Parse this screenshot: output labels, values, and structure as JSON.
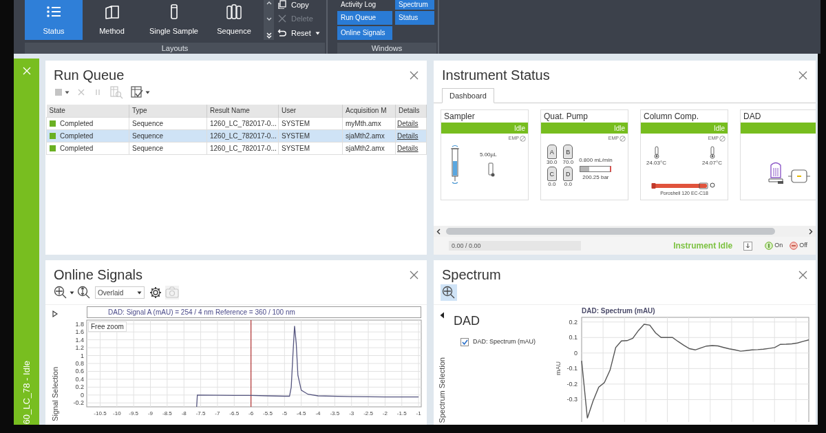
{
  "ribbon": {
    "layout_buttons": [
      {
        "label": "Status",
        "selected": true
      },
      {
        "label": "Method",
        "selected": false
      },
      {
        "label": "Single Sample",
        "selected": false
      },
      {
        "label": "Sequence",
        "selected": false
      }
    ],
    "layout_actions": [
      {
        "label": "Copy",
        "disabled": false,
        "dropdown": false
      },
      {
        "label": "Delete",
        "disabled": true,
        "dropdown": false
      },
      {
        "label": "Reset",
        "disabled": false,
        "dropdown": true
      }
    ],
    "layouts_label": "Layouts",
    "window_buttons": [
      {
        "label": "Activity Log",
        "active": false
      },
      {
        "label": "Spectrum",
        "active": true
      },
      {
        "label": "Run Queue",
        "active": true
      },
      {
        "label": "Status",
        "active": true
      },
      {
        "label": "Online Signals",
        "active": true
      }
    ],
    "windows_label": "Windows"
  },
  "instrument_tab": {
    "label": "60_LC_78 - Idle"
  },
  "run_queue": {
    "title": "Run Queue",
    "toolbar": [
      {
        "disabled": true,
        "dropdown": true
      },
      {
        "disabled": true,
        "dropdown": false
      },
      {
        "disabled": true,
        "dropdown": false
      },
      {
        "disabled": true,
        "dropdown": false
      },
      {
        "disabled": false,
        "dropdown": true
      }
    ],
    "columns": [
      "State",
      "Type",
      "Result Name",
      "User",
      "Acquisition M",
      "Details"
    ],
    "rows": [
      {
        "state": "Completed",
        "color": "#6ab023",
        "type": "Sequence",
        "result_name": "1260_LC_782017-0...",
        "user": "SYSTEM",
        "method": "myMth.amx",
        "details": "Details",
        "selected": false
      },
      {
        "state": "Completed",
        "color": "#6ab023",
        "type": "Sequence",
        "result_name": "1260_LC_782017-0...",
        "user": "SYSTEM",
        "method": "sjaMth2.amx",
        "details": "Details",
        "selected": true
      },
      {
        "state": "Completed",
        "color": "#6ab023",
        "type": "Sequence",
        "result_name": "1260_LC_782017-0...",
        "user": "SYSTEM",
        "method": "sjaMth2.amx",
        "details": "Details",
        "selected": false
      }
    ]
  },
  "instrument_status": {
    "title": "Instrument Status",
    "tabs": [
      {
        "label": "Dashboard",
        "selected": true
      }
    ],
    "modules": [
      {
        "kind": "sampler",
        "name": "Sampler",
        "status": "Idle",
        "color": "#77bd1f",
        "badge": "EMP",
        "volume": "5.00µL"
      },
      {
        "kind": "pump",
        "name": "Quat. Pump",
        "status": "Idle",
        "color": "#77bd1f",
        "badge": "EMP",
        "solvents": [
          {
            "letter": "A",
            "percent": "30.0"
          },
          {
            "letter": "B",
            "percent": "70.0"
          },
          {
            "letter": "C",
            "percent": "0.0"
          },
          {
            "letter": "D",
            "percent": "0.0"
          }
        ],
        "flow": "0.800 mL/min",
        "pressure": "200.25 bar",
        "pressure_gauge": {
          "level": 0.3
        }
      },
      {
        "kind": "column",
        "name": "Column Comp.",
        "status": "Idle",
        "color": "#77bd1f",
        "badge": "EMP",
        "temp_left": "24.03°C",
        "temp_right": "24.07°C",
        "column_name": "Poroshell 120 EC-C18"
      },
      {
        "kind": "detector",
        "name": "DAD",
        "color": "#77bd1f"
      }
    ],
    "progress": "0.00 / 0.00",
    "status_text": "Instrument Idle",
    "on_label": "On",
    "off_label": "Off"
  },
  "online_signals": {
    "title": "Online Signals",
    "toolbar": [
      {
        "kind": "button",
        "dropdown": true,
        "disabled": false
      },
      {
        "kind": "button",
        "dropdown": false,
        "disabled": false
      },
      {
        "kind": "select",
        "value": "Overlaid"
      },
      {
        "kind": "button",
        "dropdown": false,
        "disabled": false
      },
      {
        "kind": "button",
        "dropdown": false,
        "disabled": true
      }
    ],
    "side_label": "Signal Selection",
    "zoom_label": "Free zoom",
    "chart_data": {
      "type": "line",
      "title": "DAD: Signal A (mAU) = 254 / 4 nm Reference = 360 / 100 nm",
      "x": [
        -7.62,
        -7.6,
        -6.5,
        -6,
        -5.5,
        -5,
        -4.85,
        -4.8,
        -4.75,
        -4.7,
        -4.65,
        -4.6,
        -4.5,
        -4.3,
        -4,
        -3,
        -2,
        -1
      ],
      "series": [
        {
          "color": "#55557f",
          "values": [
            -0.3,
            0.0,
            -0.01,
            -0.01,
            -0.02,
            -0.03,
            -0.03,
            0.2,
            1.0,
            1.75,
            1.3,
            0.5,
            0.12,
            0.02,
            -0.02,
            -0.04,
            -0.05,
            -0.05
          ]
        }
      ],
      "xlim": [
        -10.9,
        -0.92
      ],
      "ylim": [
        -0.3,
        1.9
      ],
      "xticks": [
        -10.5,
        -10,
        -9.5,
        -9,
        -8.5,
        -8,
        -7.5,
        -7,
        -6.5,
        -6,
        -5.5,
        -5,
        -4.5,
        -4,
        -3.5,
        -3,
        -2.5,
        -2,
        -1.5,
        -1
      ],
      "yticks": [
        -0.2,
        0,
        0.2,
        0.4,
        0.6,
        0.8,
        1,
        1.2,
        1.4,
        1.6,
        1.8
      ],
      "grid": true,
      "ref_lines": [
        {
          "axis": "x",
          "value": -6,
          "color": "#b03030"
        }
      ]
    }
  },
  "spectrum": {
    "title": "Spectrum",
    "toolbar": [
      {
        "selected": true
      }
    ],
    "side_label": "Spectrum Selection",
    "group": "DAD",
    "signals": [
      {
        "label": "DAD: Spectrum (mAU)",
        "checked": true
      }
    ],
    "chart_data": {
      "type": "line",
      "title": "DAD: Spectrum (mAU)",
      "ylabel": "mAU",
      "categories": [
        null,
        null,
        null,
        null,
        null,
        null,
        null,
        null,
        null,
        null,
        null,
        null,
        null,
        null,
        null,
        null,
        null,
        null,
        null,
        null,
        null,
        null,
        null,
        null,
        null,
        null,
        null,
        null,
        null,
        null,
        null,
        null,
        null,
        null,
        null,
        null,
        null,
        null,
        null,
        null,
        null
      ],
      "series": [
        {
          "color": "#555555",
          "values": [
            -0.05,
            -0.42,
            -0.31,
            -0.22,
            -0.19,
            -0.11,
            0.035,
            0.078,
            0.08,
            0.095,
            0.145,
            0.185,
            0.18,
            0.13,
            0.1,
            0.1,
            0.1,
            0.074,
            0.05,
            0.028,
            0.02,
            0.033,
            0.045,
            0.048,
            0.046,
            0.036,
            0.027,
            0.02,
            0.012,
            0.016,
            0.02,
            0.022,
            0.025,
            0.03,
            0.035,
            0.056,
            0.057,
            0.059,
            0.065,
            0.075,
            0.085
          ]
        }
      ],
      "ylim": [
        -0.44,
        0.23
      ],
      "yticks": [
        -0.3,
        -0.2,
        -0.1,
        0,
        0.1,
        0.2
      ],
      "grid": true
    }
  }
}
